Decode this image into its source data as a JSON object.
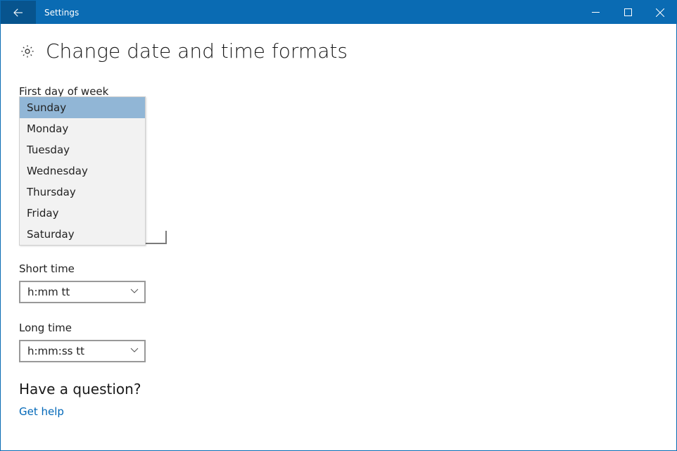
{
  "window": {
    "title": "Settings"
  },
  "page": {
    "heading": "Change date and time formats",
    "first_day_label": "First day of week",
    "first_day_options": [
      "Sunday",
      "Monday",
      "Tuesday",
      "Wednesday",
      "Thursday",
      "Friday",
      "Saturday"
    ],
    "first_day_selected": "Sunday",
    "short_time_label": "Short time",
    "short_time_value": "h:mm tt",
    "long_time_label": "Long time",
    "long_time_value": "h:mm:ss tt",
    "question_heading": "Have a question?",
    "get_help": "Get help"
  }
}
